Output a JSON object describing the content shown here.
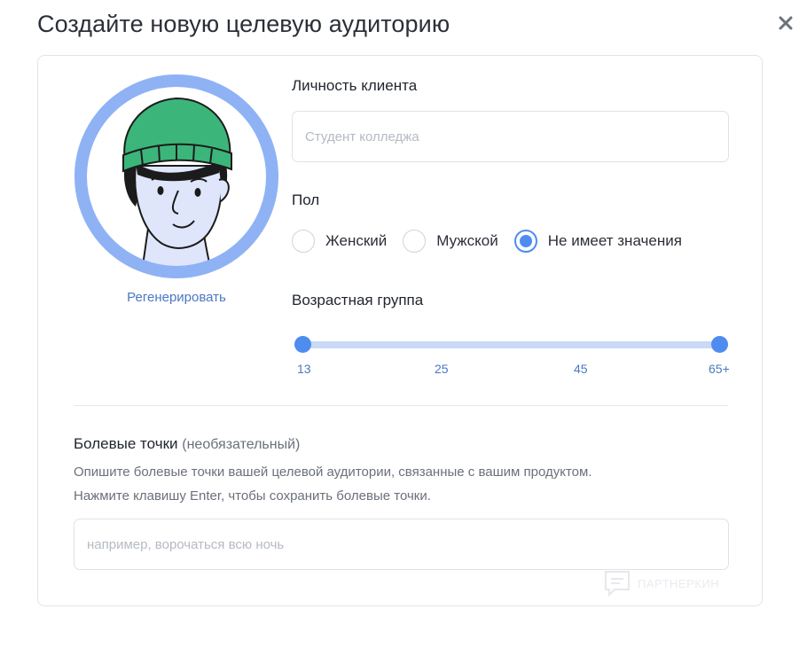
{
  "dialog": {
    "title": "Создайте новую целевую аудиторию",
    "close_icon": "close-icon"
  },
  "avatar": {
    "icon": "avatar-illustration",
    "regenerate_label": "Регенерировать",
    "ring_color": "#8fb2f5"
  },
  "persona": {
    "label": "Личность клиента",
    "placeholder": "Студент колледжа",
    "value": ""
  },
  "gender": {
    "label": "Пол",
    "options": [
      "Женский",
      "Мужской",
      "Не имеет значения"
    ],
    "selected": "Не имеет значения"
  },
  "age": {
    "label": "Возрастная группа",
    "ticks": [
      "13",
      "25",
      "45",
      "65+"
    ],
    "range_min": "13",
    "range_max": "65+"
  },
  "pain_points": {
    "label": "Болевые точки",
    "optional": "(необязательный)",
    "help_line1": "Опишите болевые точки вашей целевой аудитории, связанные с вашим продуктом.",
    "help_line2": "Нажмите клавишу Enter, чтобы сохранить болевые точки.",
    "placeholder": "например, ворочаться всю ночь",
    "value": ""
  },
  "watermark": {
    "text": "ПАРТНЕРКИН",
    "icon": "chat-bubble-icon"
  },
  "colors": {
    "accent": "#4f8cf0",
    "link": "#4a78c2",
    "track": "#c9d9f6"
  }
}
